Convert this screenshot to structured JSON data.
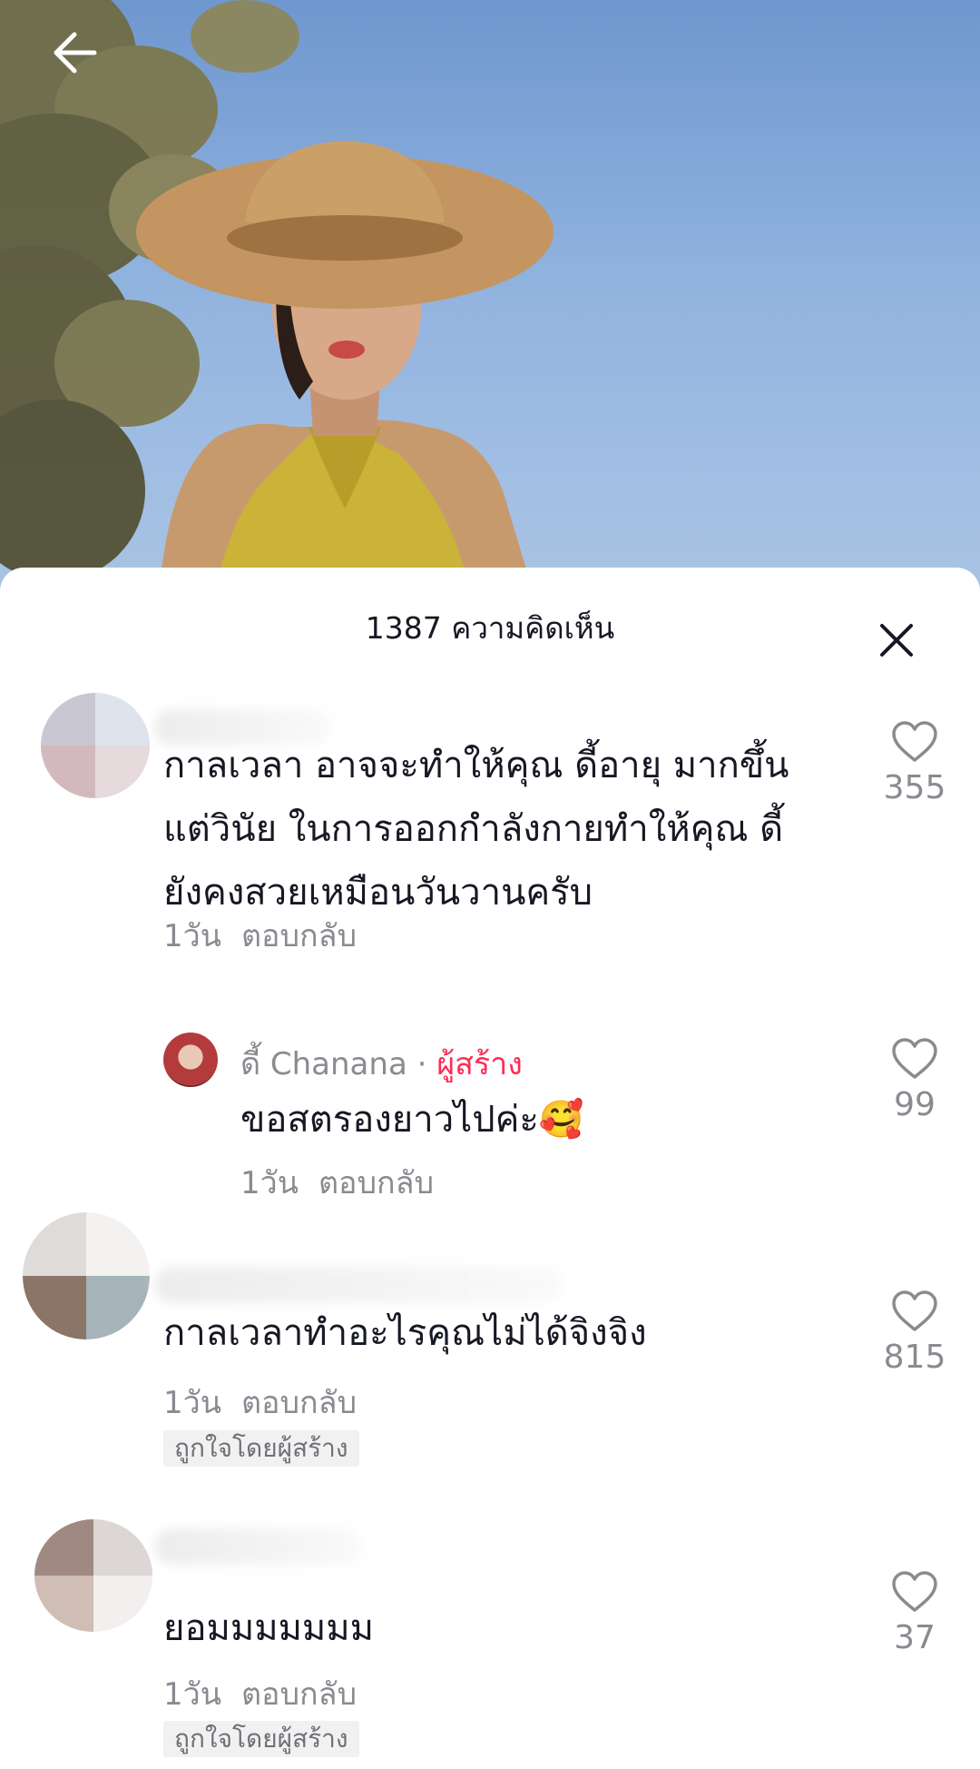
{
  "header": {
    "back_icon": "arrow-left-icon"
  },
  "sheet": {
    "title": "1387 ความคิดเห็น",
    "close_icon": "close-icon"
  },
  "comments": [
    {
      "lines": [
        "กาลเวลา อาจจะทำให้คุณ ดี้อายุ มากขึ้น",
        "แต่วินัย ในการออกกำลังกายทำให้คุณ ดี้",
        "ยังคงสวยเหมือนวันวานครับ"
      ],
      "time": "1วัน",
      "reply_label": "ตอบกลับ",
      "likes": "355",
      "reply": {
        "name": "ดี้ Chanana",
        "separator": "·",
        "creator_label": "ผู้สร้าง",
        "text": "ขอสตรองยาวไปค่ะ🥰",
        "time": "1วัน",
        "reply_label": "ตอบกลับ",
        "likes": "99"
      }
    },
    {
      "lines": [
        "กาลเวลาทำอะไรคุณไม่ได้จิงจิง"
      ],
      "time": "1วัน",
      "reply_label": "ตอบกลับ",
      "likes": "815",
      "liked_by_creator": "ถูกใจโดยผู้สร้าง"
    },
    {
      "lines": [
        "ยอมมมมมมม"
      ],
      "time": "1วัน",
      "reply_label": "ตอบกลับ",
      "likes": "37",
      "liked_by_creator": "ถูกใจโดยผู้สร้าง"
    }
  ],
  "colors": {
    "creator_accent": "#fe2c55",
    "text_primary": "#161823",
    "text_secondary": "#8a8b91"
  }
}
